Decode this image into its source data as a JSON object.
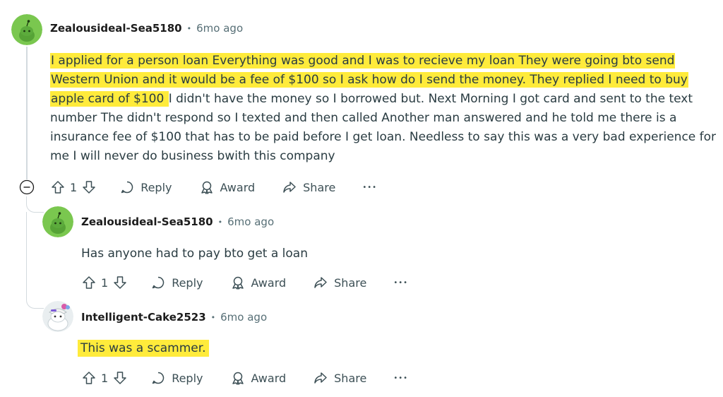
{
  "comments": [
    {
      "username": "Zealousideal-Sea5180",
      "time": "6mo ago",
      "body_highlighted": [
        "I applied for a person loan Everything was good and I was to recieve my loan They were going bto send",
        "Western Union and it would be a fee of $100 so I ask how do I send the money. They replied I need to buy",
        "apple card of $100 "
      ],
      "body_rest_line3": " I didn't have the money so I borrowed but. Next Morning I got card and sent to the text",
      "body_plain": [
        "number  The didn't respond so I texted and then called  Another man answered and he told me there is a",
        "insurance fee of $100 that has to be paid before I get loan. Needless to say this was a very bad experience for",
        "me I will never do business bwith this company"
      ],
      "votes": "1"
    },
    {
      "username": "Zealousideal-Sea5180",
      "time": "6mo ago",
      "body": "Has anyone had to pay bto get a loan",
      "votes": "1"
    },
    {
      "username": "Intelligent-Cake2523",
      "time": "6mo ago",
      "body": "This was a scammer.",
      "votes": "1"
    }
  ],
  "actions": {
    "reply": "Reply",
    "award": "Award",
    "share": "Share",
    "more": "•••"
  },
  "separator": "•",
  "colors": {
    "highlight": "#ffeb3b",
    "avatar_green": "#7ac74f",
    "thread_line": "#d3dade"
  }
}
